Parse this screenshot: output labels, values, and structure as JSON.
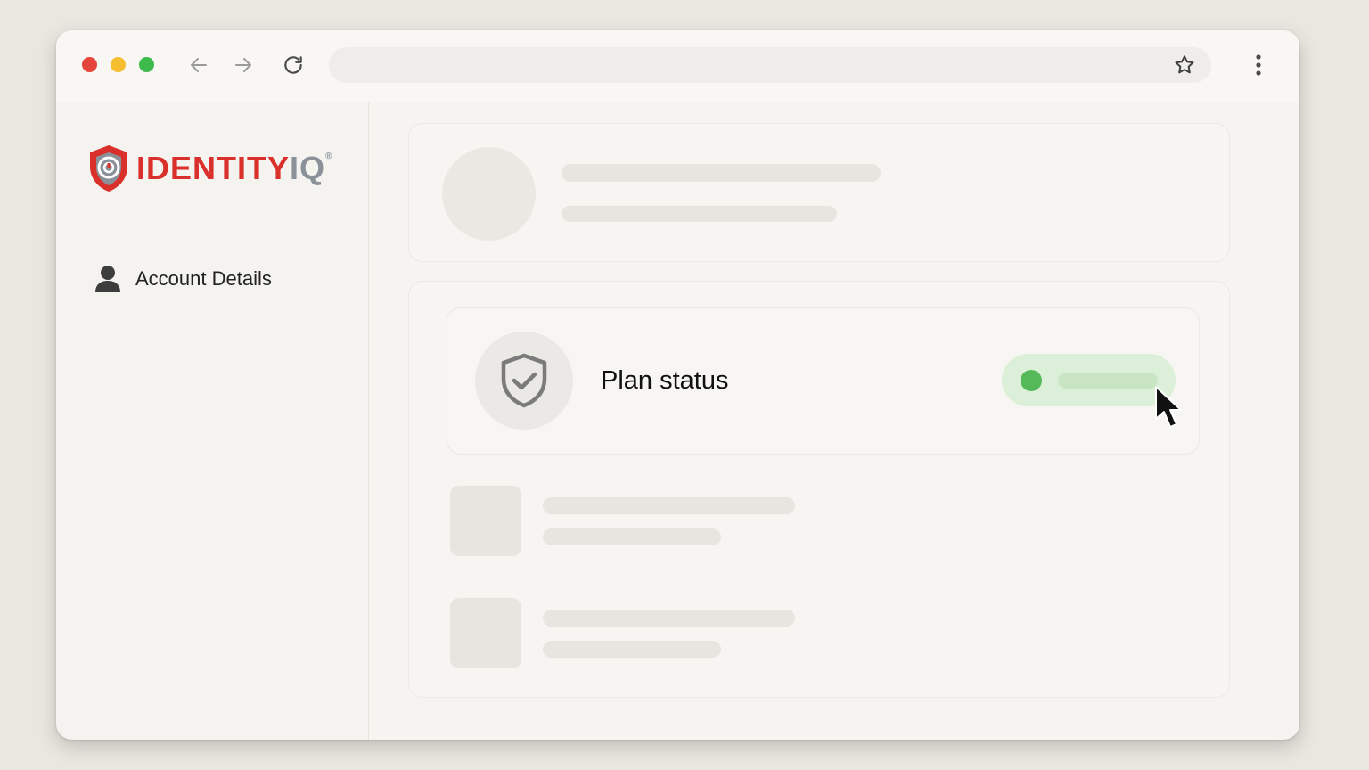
{
  "window": {
    "traffic_lights": [
      {
        "name": "close",
        "color": "#e5443a"
      },
      {
        "name": "minimize",
        "color": "#f5bd30"
      },
      {
        "name": "maximize",
        "color": "#3fba4c"
      }
    ],
    "toolbar": {
      "back_icon": "arrow-left-icon",
      "forward_icon": "arrow-right-icon",
      "reload_icon": "reload-icon",
      "address": "",
      "bookmark_icon": "star-icon",
      "menu_icon": "more-vertical-icon"
    }
  },
  "sidebar": {
    "logo": {
      "part1": "IDENTITY",
      "part2": "IQ",
      "reg": "®",
      "colors": {
        "red": "#d9302b",
        "gray": "#8a9199"
      }
    },
    "items": [
      {
        "label": "Account Details",
        "icon": "user-icon"
      }
    ]
  },
  "main": {
    "plan": {
      "label": "Plan status",
      "icon": "shield-check-icon",
      "status_color": "#55b95a",
      "status_bg": "#dcefd8"
    }
  }
}
